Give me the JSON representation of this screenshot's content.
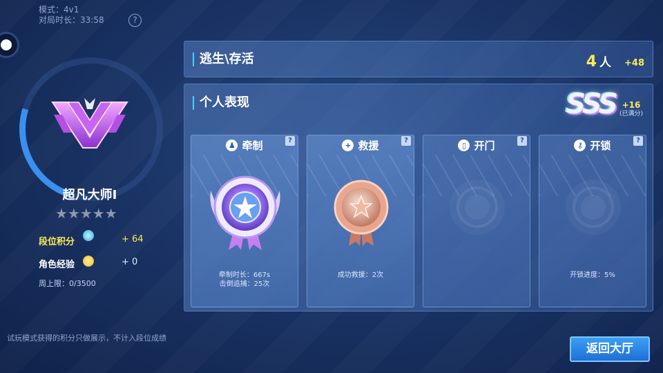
{
  "meta": {
    "mode": "模式：4v1",
    "duration": "对局时长：33:58",
    "help_glyph": "?"
  },
  "player": {
    "rank_name": "超凡大师Ⅰ",
    "stars": "★★★★★",
    "stats": [
      {
        "label": "段位积分",
        "value": "+ 64",
        "label_color": "#ffe85a"
      },
      {
        "label": "角色经验",
        "value": "+ 0",
        "label_color": "#ffffff"
      }
    ],
    "weekly_cap": "周上限：0/3500"
  },
  "escape": {
    "title": "逃生\\存活",
    "count": "4",
    "unit": "人",
    "bonus": "+48"
  },
  "performance": {
    "title": "个人表现",
    "grade": "SSS",
    "bonus": "+16",
    "bonus_note": "(已满分)",
    "cards": [
      {
        "title": "牵制",
        "icon": "person-icon",
        "glyph": "♟",
        "lines": [
          "牵制时长：667s",
          "击倒追捕：25次"
        ],
        "medal": "diamond"
      },
      {
        "title": "救援",
        "icon": "rescue-icon",
        "glyph": "+",
        "lines": [
          "成功救援：2次"
        ],
        "medal": "bronze"
      },
      {
        "title": "开门",
        "icon": "door-icon",
        "glyph": "▯",
        "lines": [],
        "medal": "none"
      },
      {
        "title": "开锁",
        "icon": "key-icon",
        "glyph": "⚷",
        "lines": [
          "开锁进度：5%"
        ],
        "medal": "none"
      }
    ],
    "help_glyph": "?"
  },
  "footnote": "试玩模式获得的积分只做展示，不计入段位成绩",
  "back_button": "返回大厅",
  "colors": {
    "accent": "#3fd6ff",
    "gold": "#ffe85a",
    "button": "#1f6fd6"
  }
}
